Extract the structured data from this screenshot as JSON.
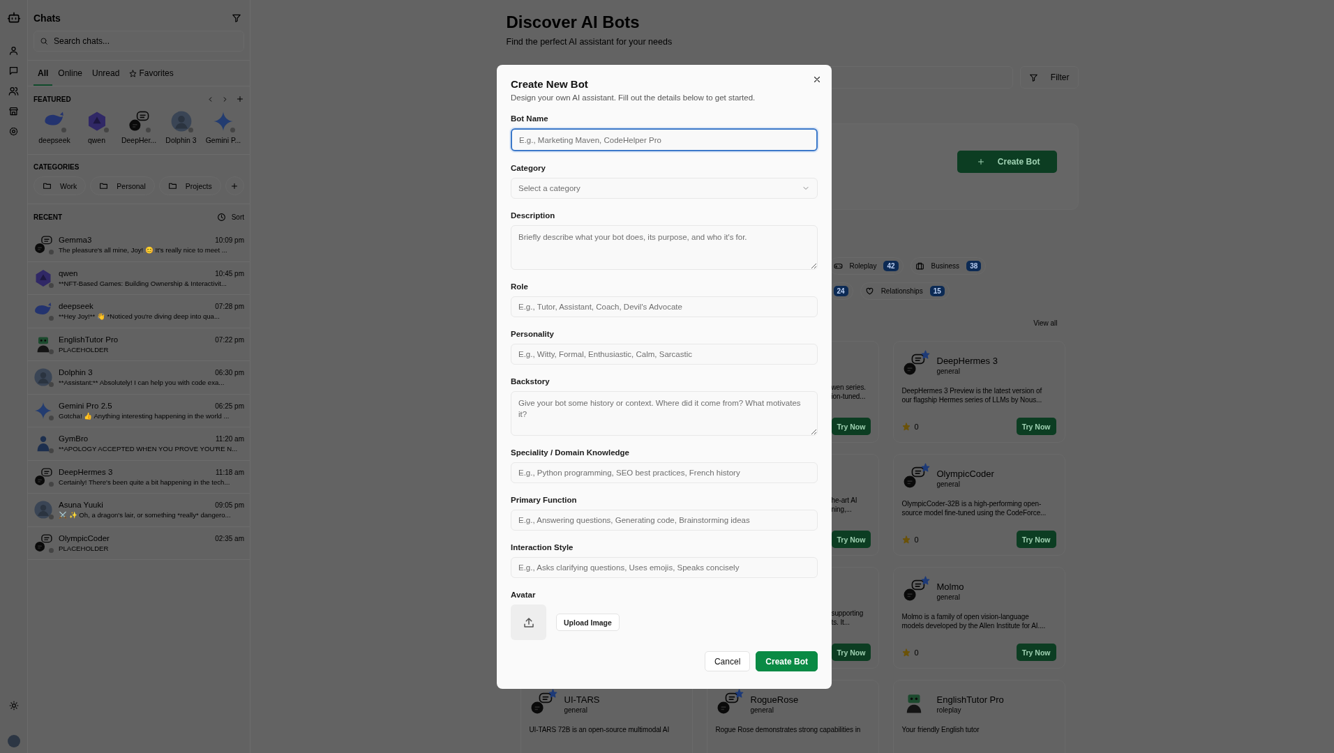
{
  "sidebar": {
    "title": "Chats",
    "search": {
      "placeholder": "Search chats..."
    },
    "tabs": [
      {
        "label": "All",
        "selected": true,
        "kind": "plain"
      },
      {
        "label": "Online",
        "selected": false,
        "kind": "plain"
      },
      {
        "label": "Unread",
        "selected": false,
        "kind": "plain"
      },
      {
        "label": "Favorites",
        "selected": false,
        "kind": "star"
      }
    ],
    "featured": {
      "heading": "FEATURED",
      "items": [
        {
          "name": "deepseek",
          "kind": "whale",
          "online": false
        },
        {
          "name": "qwen",
          "kind": "hexagon",
          "online": false
        },
        {
          "name": "DeepHer...",
          "kind": "ai-bubble",
          "online": false
        },
        {
          "name": "Dolphin 3",
          "kind": "photo",
          "online": false
        },
        {
          "name": "Gemini P...",
          "kind": "sparkle",
          "online": false
        }
      ]
    },
    "categories": {
      "heading": "CATEGORIES",
      "items": [
        "Work",
        "Personal",
        "Projects"
      ]
    },
    "recent": {
      "heading": "RECENT",
      "sort_label": "Sort",
      "chats": [
        {
          "name": "Gemma3",
          "time": "10:09 pm",
          "preview": "The pleasure's all mine, Joy! 😊 It's really nice to meet ...",
          "kind": "ai-bubble",
          "online": false
        },
        {
          "name": "qwen",
          "time": "10:45 pm",
          "preview": "**NFT-Based Games: Building Ownership & Interactivit...",
          "kind": "hexagon",
          "online": false
        },
        {
          "name": "deepseek",
          "time": "07:28 pm",
          "preview": "**Hey Joy!** 👋 *Noticed you're diving deep into qua...",
          "kind": "whale",
          "online": false
        },
        {
          "name": "EnglishTutor Pro",
          "time": "07:22 pm",
          "preview": "PLACEHOLDER",
          "kind": "robot",
          "online": false
        },
        {
          "name": "Dolphin 3",
          "time": "06:30 pm",
          "preview": "**Assistant:** Absolutely! I can help you with code exa...",
          "kind": "photo",
          "online": false
        },
        {
          "name": "Gemini Pro 2.5",
          "time": "06:25 pm",
          "preview": "Gotcha! 👍 Anything interesting happening in the world ...",
          "kind": "sparkle",
          "online": false
        },
        {
          "name": "GymBro",
          "time": "11:20 am",
          "preview": "**APOLOGY ACCEPTED WHEN YOU PROVE YOU'RE N...",
          "kind": "figure",
          "online": false
        },
        {
          "name": "DeepHermes 3",
          "time": "11:18 am",
          "preview": "Certainly! There's been quite a bit happening in the tech...",
          "kind": "ai-bubble",
          "online": false
        },
        {
          "name": "Asuna Yuuki",
          "time": "09:05 pm",
          "preview": "⚔️ ✨ Oh, a dragon's lair, or something *really* dangero...",
          "kind": "photo",
          "online": false
        },
        {
          "name": "OlympicCoder",
          "time": "02:35 am",
          "preview": "PLACEHOLDER",
          "kind": "ai-bubble",
          "online": false
        }
      ]
    }
  },
  "main": {
    "title": "Discover AI Bots",
    "subtitle": "Find the perfect AI assistant for your needs",
    "filter_label": "Filter",
    "create_button": "Create Bot",
    "category_rows": [
      [
        {
          "label": "Roleplay",
          "count": "42",
          "kind": "gamepad"
        },
        {
          "label": "Business",
          "count": "38",
          "kind": "briefcase"
        }
      ],
      [
        {
          "count": "24"
        },
        {
          "label": "Relationships",
          "count": "15",
          "kind": "heart"
        }
      ]
    ],
    "view_all": "View all",
    "bot_cards": [
      {
        "kind": "peek",
        "description": [
          "wen series.",
          "ion-tuned..."
        ],
        "button": "Try Now"
      },
      {
        "kind": "ai-bubble",
        "featured": true,
        "name": "DeepHermes 3",
        "category": "general",
        "description": [
          "DeepHermes 3 Preview is the latest version of",
          "our flagship Hermes series of LLMs by Nous..."
        ],
        "rating": "0",
        "button": "Try Now"
      },
      {
        "kind": "peek",
        "description": [
          "he-art AI",
          "ning,..."
        ],
        "button": "Try Now"
      },
      {
        "kind": "ai-bubble",
        "featured": true,
        "name": "OlympicCoder",
        "category": "general",
        "description": [
          "OlympicCoder-32B is a high-performing open-",
          "source model fine-tuned using the CodeForce..."
        ],
        "rating": "0",
        "button": "Try Now"
      },
      {
        "kind": "peek",
        "description": [
          "supporting",
          "ts. It..."
        ],
        "button": "Try Now"
      },
      {
        "kind": "ai-bubble",
        "featured": true,
        "name": "Molmo",
        "category": "general",
        "description": [
          "Molmo is a family of open vision-language",
          "models developed by the Allen Institute for AI...."
        ],
        "rating": "0",
        "button": "Try Now"
      },
      {
        "kind": "ai-bubble",
        "featured": true,
        "name": "UI-TARS",
        "category": "general",
        "description": [
          "UI-TARS 72B is an open-source multimodal AI"
        ]
      },
      {
        "kind": "ai-bubble",
        "featured": true,
        "name": "RogueRose",
        "category": "general",
        "description": [
          "Rogue Rose demonstrates strong capabilities in"
        ]
      },
      {
        "kind": "robot",
        "featured": false,
        "name": "EnglishTutor Pro",
        "category": "roleplay",
        "description": [
          "Your friendly English tutor"
        ]
      }
    ]
  },
  "modal": {
    "title": "Create New Bot",
    "subtitle": "Design your own AI assistant. Fill out the details below to get started.",
    "fields": [
      {
        "kind": "input",
        "label": "Bot Name",
        "placeholder": "E.g., Marketing Maven, CodeHelper Pro",
        "focused": true
      },
      {
        "kind": "select",
        "label": "Category",
        "placeholder": "Select a category",
        "focused": false
      },
      {
        "kind": "textarea",
        "label": "Description",
        "placeholder": "Briefly describe what your bot does, its purpose, and who it's for.",
        "focused": false
      },
      {
        "kind": "input",
        "label": "Role",
        "placeholder": "E.g., Tutor, Assistant, Coach, Devil's Advocate",
        "focused": false
      },
      {
        "kind": "input",
        "label": "Personality",
        "placeholder": "E.g., Witty, Formal, Enthusiastic, Calm, Sarcastic",
        "focused": false
      },
      {
        "kind": "textarea",
        "label": "Backstory",
        "placeholder": "Give your bot some history or context. Where did it come from? What motivates it?",
        "focused": false
      },
      {
        "kind": "input",
        "label": "Speciality / Domain Knowledge",
        "placeholder": "E.g., Python programming, SEO best practices, French history",
        "focused": false
      },
      {
        "kind": "input",
        "label": "Primary Function",
        "placeholder": "E.g., Answering questions, Generating code, Brainstorming ideas",
        "focused": false
      },
      {
        "kind": "input",
        "label": "Interaction Style",
        "placeholder": "E.g., Asks clarifying questions, Uses emojis, Speaks concisely",
        "focused": false
      },
      {
        "kind": "avatar",
        "label": "Avatar",
        "button": "Upload Image"
      }
    ],
    "buttons": [
      {
        "label": "Cancel",
        "kind": "secondary"
      },
      {
        "label": "Create Bot",
        "kind": "primary"
      }
    ]
  }
}
